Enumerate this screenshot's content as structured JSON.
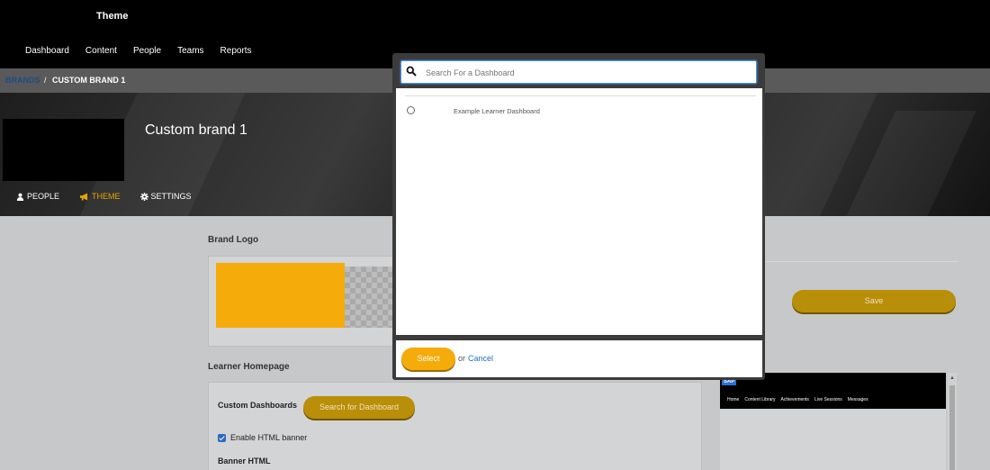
{
  "header": {
    "title": "Theme",
    "nav": [
      "Dashboard",
      "Content",
      "People",
      "Teams",
      "Reports"
    ]
  },
  "breadcrumb": {
    "parent": "BRANDS",
    "separator": "/",
    "current": "CUSTOM BRAND 1"
  },
  "brand": {
    "name": "Custom brand 1",
    "tabs": [
      {
        "label": "PEOPLE",
        "icon": "person-icon"
      },
      {
        "label": "THEME",
        "icon": "megaphone-icon",
        "active": true
      },
      {
        "label": "SETTINGS",
        "icon": "gear-icon"
      }
    ]
  },
  "content": {
    "brand_logo_title": "Brand Logo",
    "save_label": "Save",
    "learner_homepage_title": "Learner Homepage",
    "custom_dashboards_label": "Custom Dashboards",
    "search_dashboard_button": "Search for Dashboard",
    "enable_html_banner_label": "Enable HTML banner",
    "enable_html_banner_checked": true,
    "banner_html_label": "Banner HTML"
  },
  "preview": {
    "logo_text": "SAP",
    "nav": [
      "Home",
      "Content Library",
      "Achievements",
      "Live Sessions",
      "Messages"
    ]
  },
  "modal": {
    "search_placeholder": "Search For a Dashboard",
    "options": [
      "Example Learner Dashboard"
    ],
    "select_label": "Select",
    "or_text": "or",
    "cancel_label": "Cancel"
  },
  "colors": {
    "accent": "#f5ab0a",
    "accent_dark": "#b98e08",
    "link": "#1f6fc2",
    "header_bg": "#000000"
  }
}
